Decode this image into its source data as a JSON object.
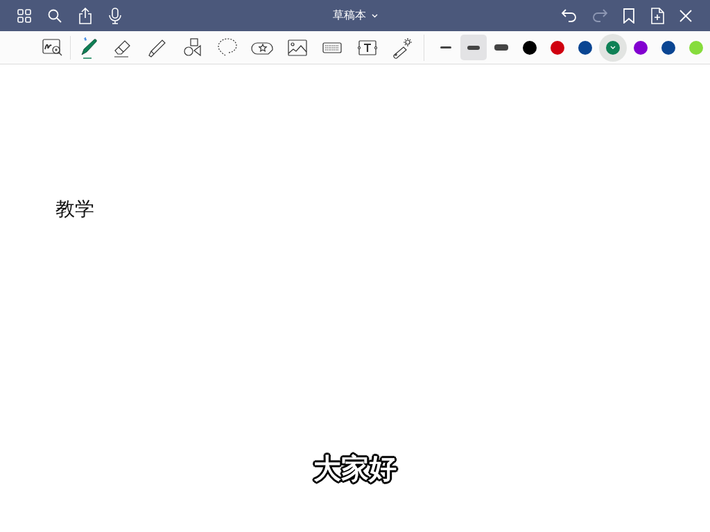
{
  "title": "草稿本",
  "tools": [
    {
      "kind": "zoom-window",
      "selected": false
    },
    {
      "kind": "pen",
      "selected": true
    },
    {
      "kind": "eraser",
      "selected": false
    },
    {
      "kind": "highlighter",
      "selected": false
    },
    {
      "kind": "shapes",
      "selected": false
    },
    {
      "kind": "lasso",
      "selected": false
    },
    {
      "kind": "sticker",
      "selected": false
    },
    {
      "kind": "image",
      "selected": false
    },
    {
      "kind": "keyboard",
      "selected": false
    },
    {
      "kind": "text",
      "selected": false
    },
    {
      "kind": "laser",
      "selected": false
    }
  ],
  "stroke_widths": [
    {
      "selected": false
    },
    {
      "selected": true
    },
    {
      "selected": false
    }
  ],
  "colors": [
    {
      "color": "#000000",
      "selected": false
    },
    {
      "color": "#d0000f",
      "selected": false
    },
    {
      "color": "#0a4592",
      "selected": false
    },
    {
      "color": "#0e8055",
      "selected": true
    },
    {
      "color": "#8200d0",
      "selected": false
    },
    {
      "color": "#0a4592",
      "selected": false
    },
    {
      "color": "#86dc3c",
      "selected": false
    }
  ],
  "canvas_text": "教学",
  "caption": "大家好"
}
